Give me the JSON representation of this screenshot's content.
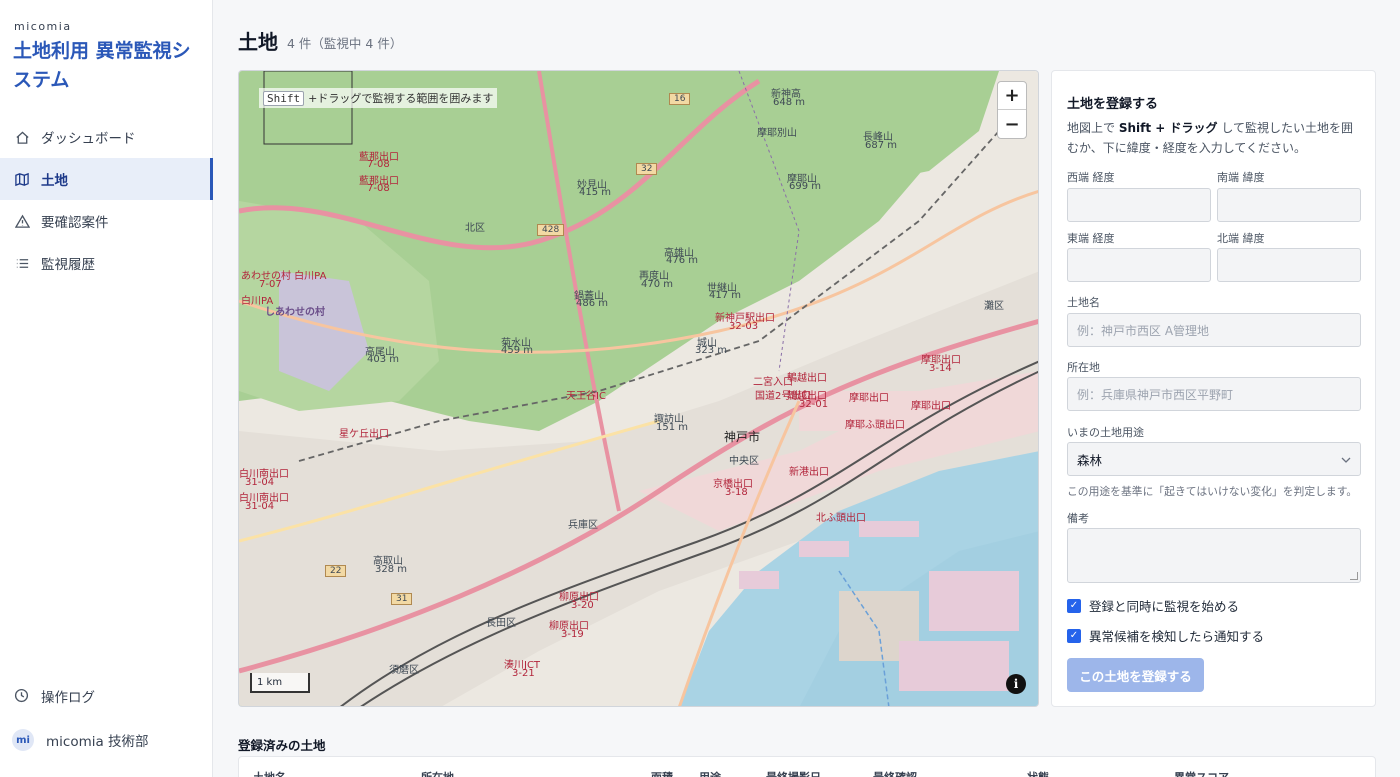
{
  "brand": {
    "small": "micomia",
    "title": "土地利用 異常監視システム"
  },
  "nav": [
    {
      "label": "ダッシュボード",
      "icon": "home-icon",
      "active": false
    },
    {
      "label": "土地",
      "icon": "map-icon",
      "active": true
    },
    {
      "label": "要確認案件",
      "icon": "warning-icon",
      "active": false
    },
    {
      "label": "監視履歴",
      "icon": "list-icon",
      "active": false
    }
  ],
  "sidebar_bottom": {
    "op_log": "操作ログ",
    "user_initials": "mi",
    "user_name": "micomia 技術部"
  },
  "header": {
    "title": "土地",
    "count": "4 件（監視中 4 件）"
  },
  "map": {
    "hint_key": "Shift",
    "hint_text": "+ドラッグで監視する範囲を囲みます",
    "zoom_in": "+",
    "zoom_out": "−",
    "scale": "1 km",
    "info": "i",
    "labels": {
      "kobe": "神戸市",
      "chuo": "中央区",
      "kita": "北区",
      "hyogo": "兵庫区",
      "nagata": "長田区",
      "suma": "須磨区",
      "nada": "灘区",
      "myoken": "妙見山",
      "myoken_h": "415 m",
      "takao": "高雄山",
      "takao_h": "476 m",
      "futatabi": "再度山",
      "futatabi_h": "470 m",
      "nabekabuto": "鍋蓋山",
      "nabekabuto_h": "486 m",
      "kikusui": "菊水山",
      "kikusui_h": "459 m",
      "takao2": "高尾山",
      "takao2_h": "403 m",
      "shindo": "新神高",
      "shindo_h": "648 m",
      "maya_betsu": "摩耶別山",
      "nagamine": "長峰山",
      "nagamine_h": "687 m",
      "maya": "摩耶山",
      "maya_h": "699 m",
      "setsu": "世継山",
      "setsu_h": "417 m",
      "jo": "城山",
      "jo_h": "323 m",
      "suwa": "諏訪山",
      "suwa_h": "151 m",
      "kohoku": "高取山",
      "kohoku_h": "328 m",
      "shiawase": "しあわせの村",
      "toll1": "藍那出口",
      "toll1_n": "7-08",
      "toll2": "藍那出口",
      "toll2_n": "7-08",
      "toll3": "新神戸駅出口",
      "toll3_n": "32-03",
      "toll4": "天王谷IC",
      "toll5": "京橋出口",
      "toll5_n": "3-18",
      "toll6": "摩耶出口",
      "toll7": "摩耶ふ頭出口",
      "toll8": "新港出口",
      "toll9": "北ふ頭出口",
      "toll10": "柳原出口",
      "toll10_n": "3-20",
      "toll11": "柳原出口",
      "toll11_n": "3-19",
      "toll12": "湊川JCT",
      "toll12_n": "3-21",
      "toll13": "白川南出口",
      "toll13_n": "31-04",
      "toll14": "白川南出口",
      "toll14_n": "31-04",
      "toll15": "鵯越出口",
      "toll15_n": "32-01",
      "toll16": "国道2号出口",
      "toll17": "二宮入口",
      "toll18": "摩耶出口",
      "toll18_n": "3-14",
      "toll19": "摩耶出口",
      "toll20": "あわせの村 白川PA",
      "toll20_n": "7-07",
      "toll21": "白川PA",
      "toll22": "鵯越出口",
      "toll23": "星ケ丘出口",
      "route16": "16",
      "route32": "32",
      "route428": "428",
      "route22": "22",
      "route31": "31"
    }
  },
  "form": {
    "title": "土地を登録する",
    "desc_before": "地図上で ",
    "desc_bold": "Shift + ドラッグ",
    "desc_after": " して監視したい土地を囲むか、下に緯度・経度を入力してください。",
    "west_label": "西端 経度",
    "south_label": "南端 緯度",
    "east_label": "東端 経度",
    "north_label": "北端 緯度",
    "name_label": "土地名",
    "name_placeholder": "例：神戸市西区 A管理地",
    "addr_label": "所在地",
    "addr_placeholder": "例：兵庫県神戸市西区平野町",
    "use_label": "いまの土地用途",
    "use_value": "森林",
    "use_help": "この用途を基準に「起きてはいけない変化」を判定します。",
    "note_label": "備考",
    "check1": "登録と同時に監視を始める",
    "check2": "異常候補を検知したら通知する",
    "submit": "この土地を登録する"
  },
  "registered": {
    "title": "登録済みの土地",
    "columns": [
      "土地名",
      "所在地",
      "面積",
      "用途",
      "最終撮影日",
      "最終確認",
      "状態",
      "異常スコア"
    ]
  },
  "colors": {
    "accent": "#2b58b8",
    "forest": "#a8cf94",
    "water": "#a9d3e4",
    "urban": "#e6e1da",
    "motorway": "#e892a2",
    "trunk": "#f7c59f"
  }
}
